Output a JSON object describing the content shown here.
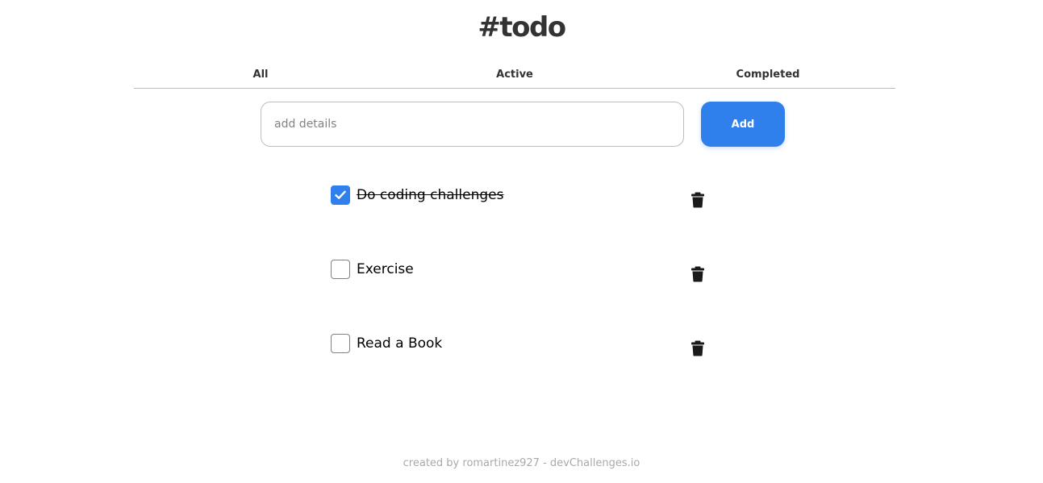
{
  "header": {
    "title": "#todo"
  },
  "tabs": [
    {
      "label": "All"
    },
    {
      "label": "Active"
    },
    {
      "label": "Completed"
    }
  ],
  "add_form": {
    "placeholder": "add details",
    "value": "",
    "button_label": "Add"
  },
  "todos": [
    {
      "text": "Do coding challenges",
      "completed": true
    },
    {
      "text": "Exercise",
      "completed": false
    },
    {
      "text": "Read a Book",
      "completed": false
    }
  ],
  "icons": {
    "checkbox_check": "check-icon",
    "delete": "trash-icon"
  },
  "colors": {
    "accent": "#2f80ed",
    "text": "#333333",
    "muted": "#a9a9a9",
    "border": "#bdbdbd"
  },
  "footer": {
    "text": "created by romartinez927 - devChallenges.io"
  }
}
